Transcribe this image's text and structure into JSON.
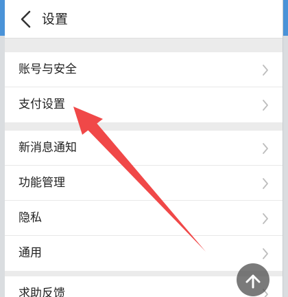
{
  "header": {
    "title": "设置",
    "back_icon": "chevron-left-icon"
  },
  "groups": [
    {
      "items": [
        {
          "label": "账号与安全"
        },
        {
          "label": "支付设置"
        }
      ]
    },
    {
      "items": [
        {
          "label": "新消息通知"
        },
        {
          "label": "功能管理"
        },
        {
          "label": "隐私"
        },
        {
          "label": "通用"
        }
      ]
    },
    {
      "items": [
        {
          "label": "求助反馈"
        }
      ]
    }
  ],
  "annotation": {
    "color": "#f04848",
    "icon": "red-arrow-annotation"
  },
  "fab": {
    "icon": "up-arrow-icon"
  },
  "colors": {
    "header_bg": "#ffffff",
    "page_bg": "#ebebeb",
    "text": "#222222",
    "chevron": "#bdbdbd"
  }
}
